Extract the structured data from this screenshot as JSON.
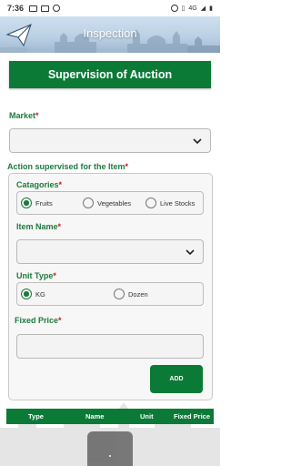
{
  "status_bar": {
    "time": "7:36",
    "network": "4G"
  },
  "header": {
    "title": "Inspection"
  },
  "banner": {
    "title": "Supervision of Auction"
  },
  "market": {
    "label": "Market",
    "required_mark": "*",
    "value": ""
  },
  "action_section": {
    "label": "Action supervised for the Item",
    "required_mark": "*"
  },
  "categories": {
    "label": "Catagories",
    "required_mark": "*",
    "options": [
      "Fruits",
      "Vegetables",
      "Live Stocks"
    ],
    "selected": "Fruits"
  },
  "item_name": {
    "label": "Item Name",
    "required_mark": "*",
    "value": ""
  },
  "unit_type": {
    "label": "Unit Type",
    "required_mark": "*",
    "options": [
      "KG",
      "Dozen"
    ],
    "selected": "KG"
  },
  "fixed_price": {
    "label": "Fixed Price",
    "required_mark": "*",
    "value": ""
  },
  "add_button": {
    "label": "ADD"
  },
  "table": {
    "columns": [
      "Type",
      "Name",
      "Unit",
      "Fixed Price"
    ]
  },
  "colors": {
    "primary_green": "#0b7a37",
    "label_green": "#1e7a3c",
    "required_red": "#d01818"
  }
}
